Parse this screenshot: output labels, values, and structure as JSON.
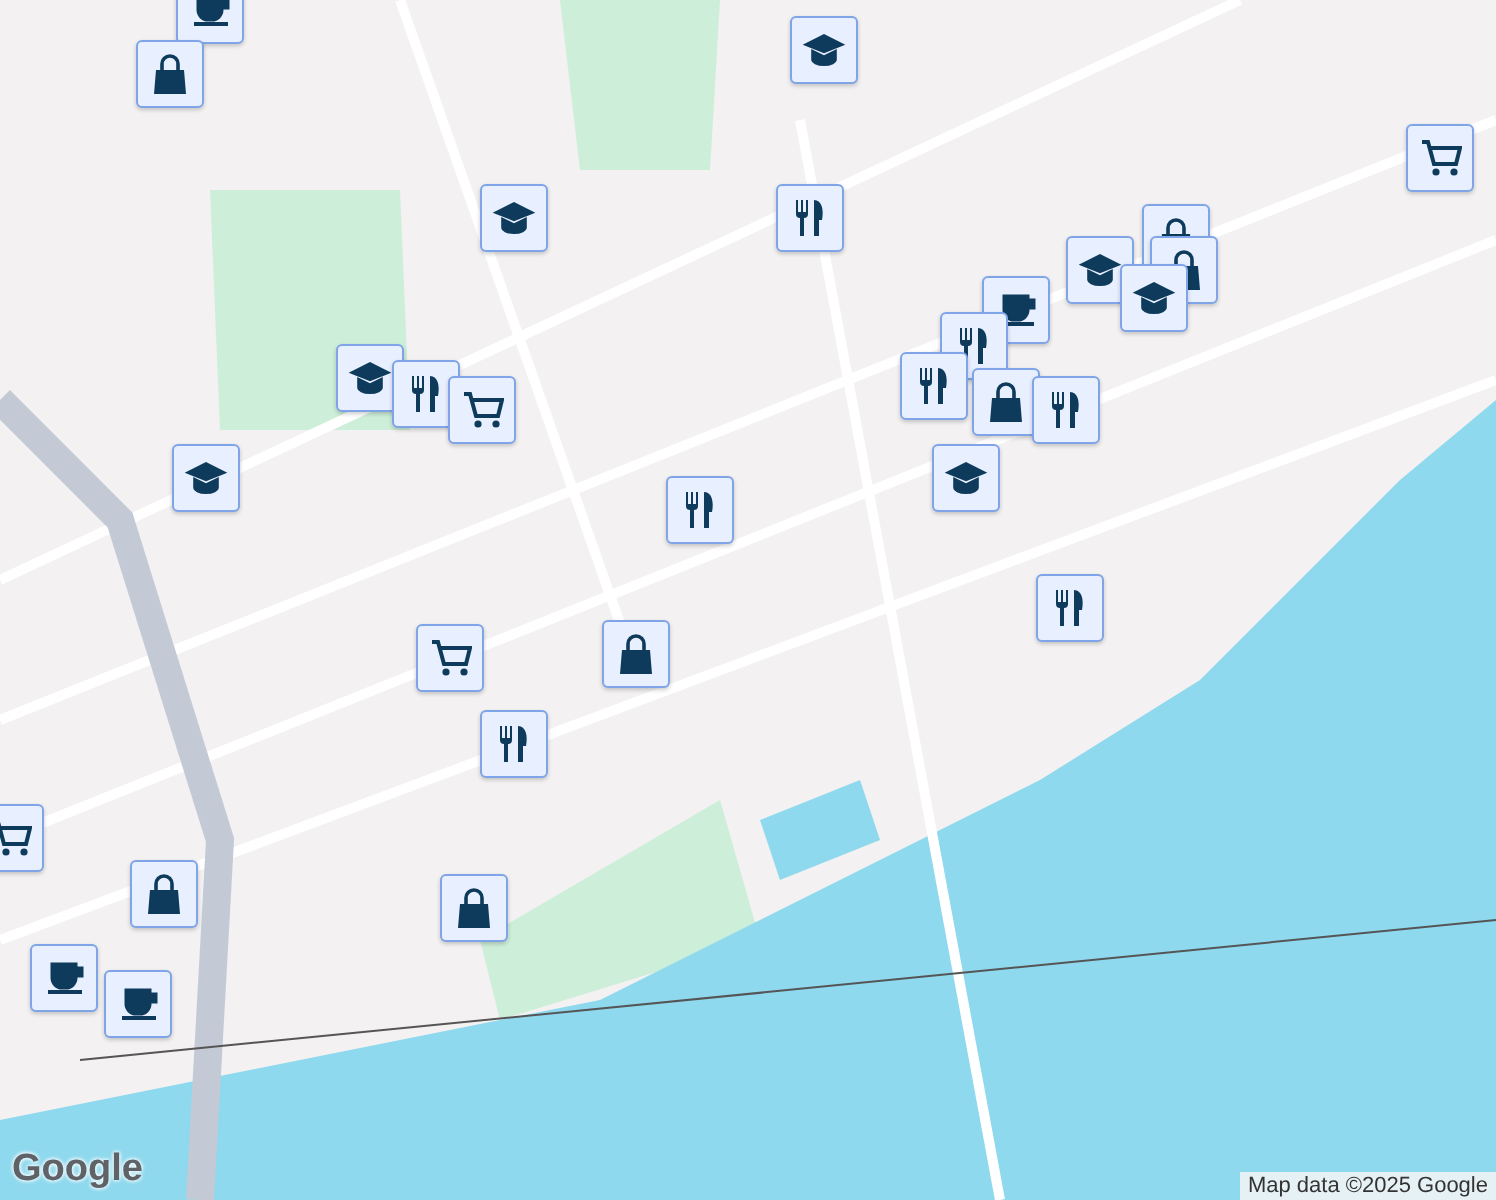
{
  "map": {
    "markers": [
      {
        "kind": "cafe"
      },
      {
        "kind": "shopping"
      },
      {
        "kind": "school"
      },
      {
        "kind": "school"
      },
      {
        "kind": "restaurant"
      },
      {
        "kind": "grocery"
      },
      {
        "kind": "school"
      },
      {
        "kind": "restaurant"
      },
      {
        "kind": "grocery"
      },
      {
        "kind": "school"
      },
      {
        "kind": "restaurant"
      },
      {
        "kind": "shopping"
      },
      {
        "kind": "shopping"
      },
      {
        "kind": "school"
      },
      {
        "kind": "cafe"
      },
      {
        "kind": "school"
      },
      {
        "kind": "restaurant"
      },
      {
        "kind": "restaurant"
      },
      {
        "kind": "shopping"
      },
      {
        "kind": "restaurant"
      },
      {
        "kind": "school"
      },
      {
        "kind": "grocery"
      },
      {
        "kind": "shopping"
      },
      {
        "kind": "restaurant"
      },
      {
        "kind": "restaurant"
      },
      {
        "kind": "grocery"
      },
      {
        "kind": "shopping"
      },
      {
        "kind": "shopping"
      },
      {
        "kind": "cafe"
      },
      {
        "kind": "cafe"
      }
    ],
    "logo": "Google",
    "attribution": "Map data ©2025 Google"
  }
}
